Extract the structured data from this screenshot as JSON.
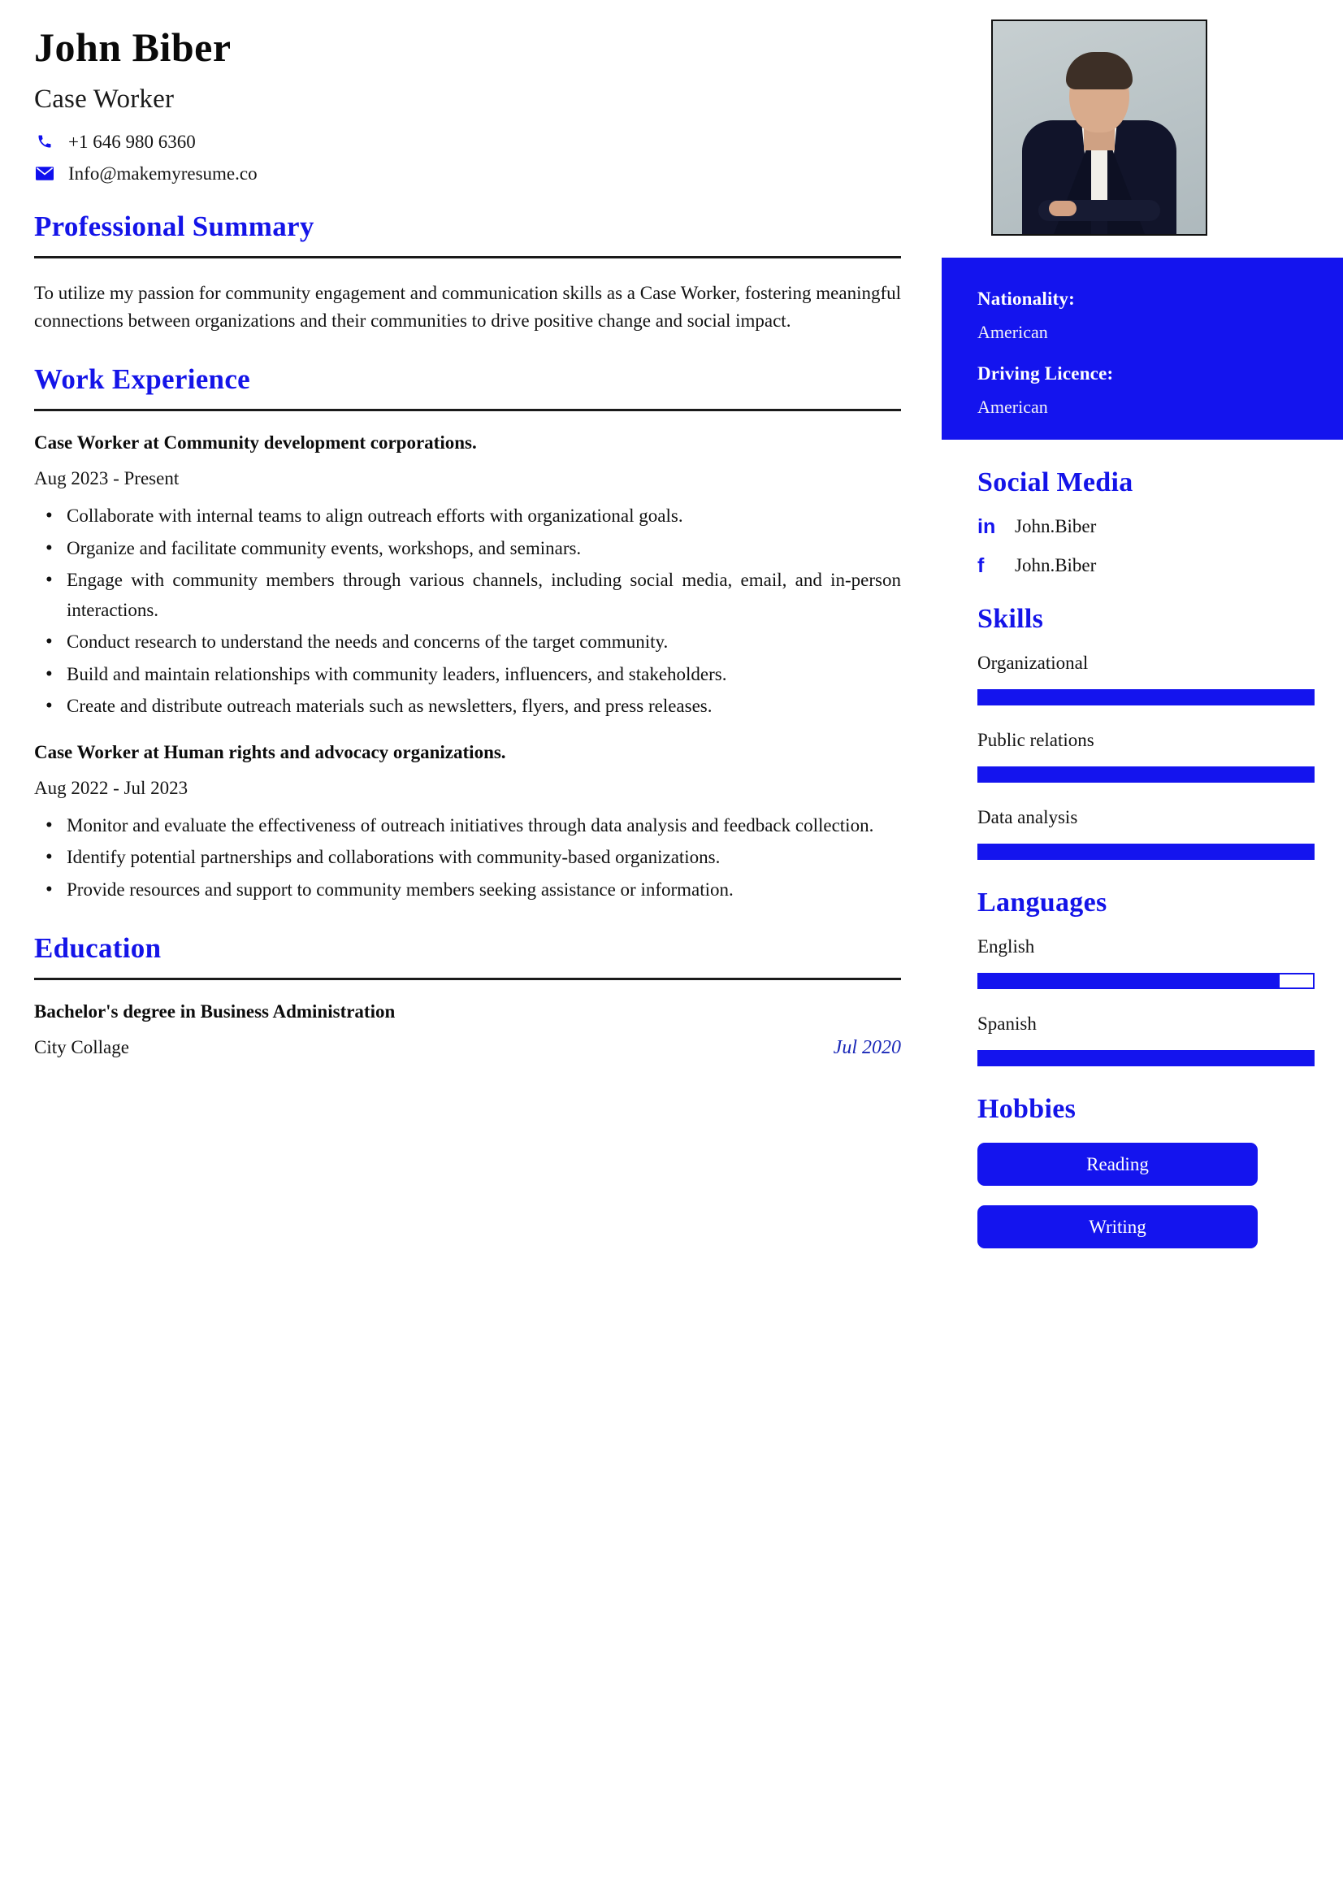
{
  "colors": {
    "accent": "#1414ee",
    "heading": "#1414e8",
    "text": "#121212",
    "white": "#ffffff"
  },
  "header": {
    "name": "John Biber",
    "job_title": "Case Worker",
    "phone": "+1 646 980 6360",
    "email": "Info@makemyresume.co",
    "phone_icon": "phone-icon",
    "email_icon": "envelope-icon"
  },
  "summary": {
    "heading": "Professional Summary",
    "text": "To utilize my passion for community engagement and communication skills as a Case Worker, fostering meaningful connections between organizations and their communities to drive positive change and social impact."
  },
  "work": {
    "heading": "Work Experience",
    "jobs": [
      {
        "title": "Case Worker at Community development corporations.",
        "dates": "Aug 2023 - Present",
        "duties": [
          "Collaborate with internal teams to align outreach efforts with organizational goals.",
          "Organize and facilitate community events, workshops, and seminars.",
          "Engage with community members through various channels, including social media, email, and in-person interactions.",
          "Conduct research to understand the needs and concerns of the target community.",
          "Build and maintain relationships with community leaders, influencers, and stakeholders.",
          "Create and distribute outreach materials such as newsletters, flyers, and press releases."
        ]
      },
      {
        "title": "Case Worker at Human rights and advocacy organizations.",
        "dates": "Aug 2022 - Jul 2023",
        "duties": [
          "Monitor and evaluate the effectiveness of outreach initiatives through data analysis and feedback collection.",
          "Identify potential partnerships and collaborations with community-based organizations.",
          "Provide resources and support to community members seeking assistance or information."
        ]
      }
    ]
  },
  "education": {
    "heading": "Education",
    "degree": "Bachelor's degree in Business Administration",
    "school": "City Collage",
    "date": "Jul 2020"
  },
  "sidebar": {
    "photo_alt": "portrait-photo",
    "info": {
      "nationality_label": "Nationality:",
      "nationality_value": "American",
      "driving_label": "Driving Licence:",
      "driving_value": "American"
    },
    "social": {
      "heading": "Social Media",
      "items": [
        {
          "icon": "linkedin-icon",
          "glyph": "in",
          "handle": "John.Biber"
        },
        {
          "icon": "facebook-icon",
          "glyph": "f",
          "handle": "John.Biber"
        }
      ]
    },
    "skills": {
      "heading": "Skills",
      "items": [
        {
          "label": "Organizational",
          "level": 100
        },
        {
          "label": "Public relations",
          "level": 100
        },
        {
          "label": "Data analysis",
          "level": 100
        }
      ]
    },
    "languages": {
      "heading": "Languages",
      "items": [
        {
          "label": "English",
          "level": 90
        },
        {
          "label": "Spanish",
          "level": 100
        }
      ]
    },
    "hobbies": {
      "heading": "Hobbies",
      "items": [
        {
          "label": "Reading"
        },
        {
          "label": "Writing"
        }
      ]
    }
  }
}
